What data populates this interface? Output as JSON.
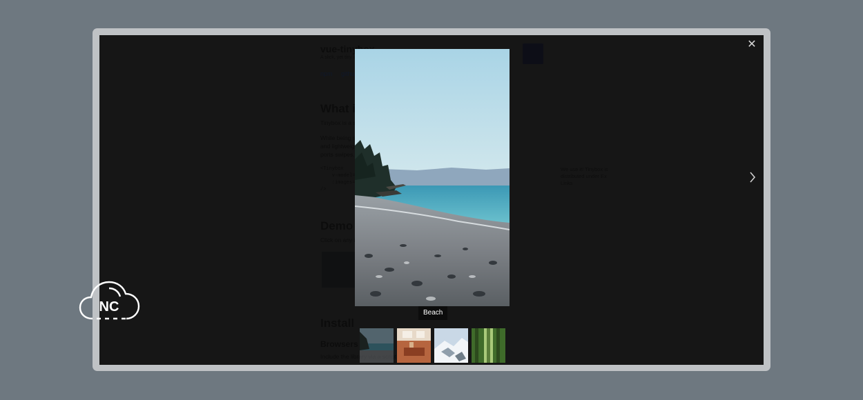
{
  "background_doc": {
    "title": "vue-tinybox",
    "subtitle": "A slick, yet tiny lightbox",
    "links": [
      "npm",
      "github"
    ],
    "section_what": "What is it?",
    "what_text1": "Tinybox is a slick, yet tiny lightbox",
    "what_text2": "While being small and dependency-free, it is very slick",
    "what_text3": "and lightweight. It works great on mobile too: it sup-",
    "what_text4": "ports swipes.",
    "code": "<Tinybox\n    v-model=\"index\"\n    :images=\"images\"\n/>",
    "side_note": "We use it! Tinybox is\ndistributed under Ex\nLinks",
    "section_demo": "Demo",
    "demo_text": "Click on any image to open the lightbox",
    "section_install": "Install",
    "section_browsers": "Browsers",
    "browsers_text": "Include the library via a script tag"
  },
  "lightbox": {
    "caption": "Beach",
    "close_symbol": "✕",
    "thumbnails": [
      "coast",
      "interior",
      "snow",
      "forest"
    ]
  },
  "logo": {
    "text": "NC"
  },
  "colors": {
    "page_bg": "#6e7880",
    "frame": "#bfc2c5",
    "overlay": "#161616",
    "sky": "#b9dde9",
    "sea": "#4aaec2"
  }
}
